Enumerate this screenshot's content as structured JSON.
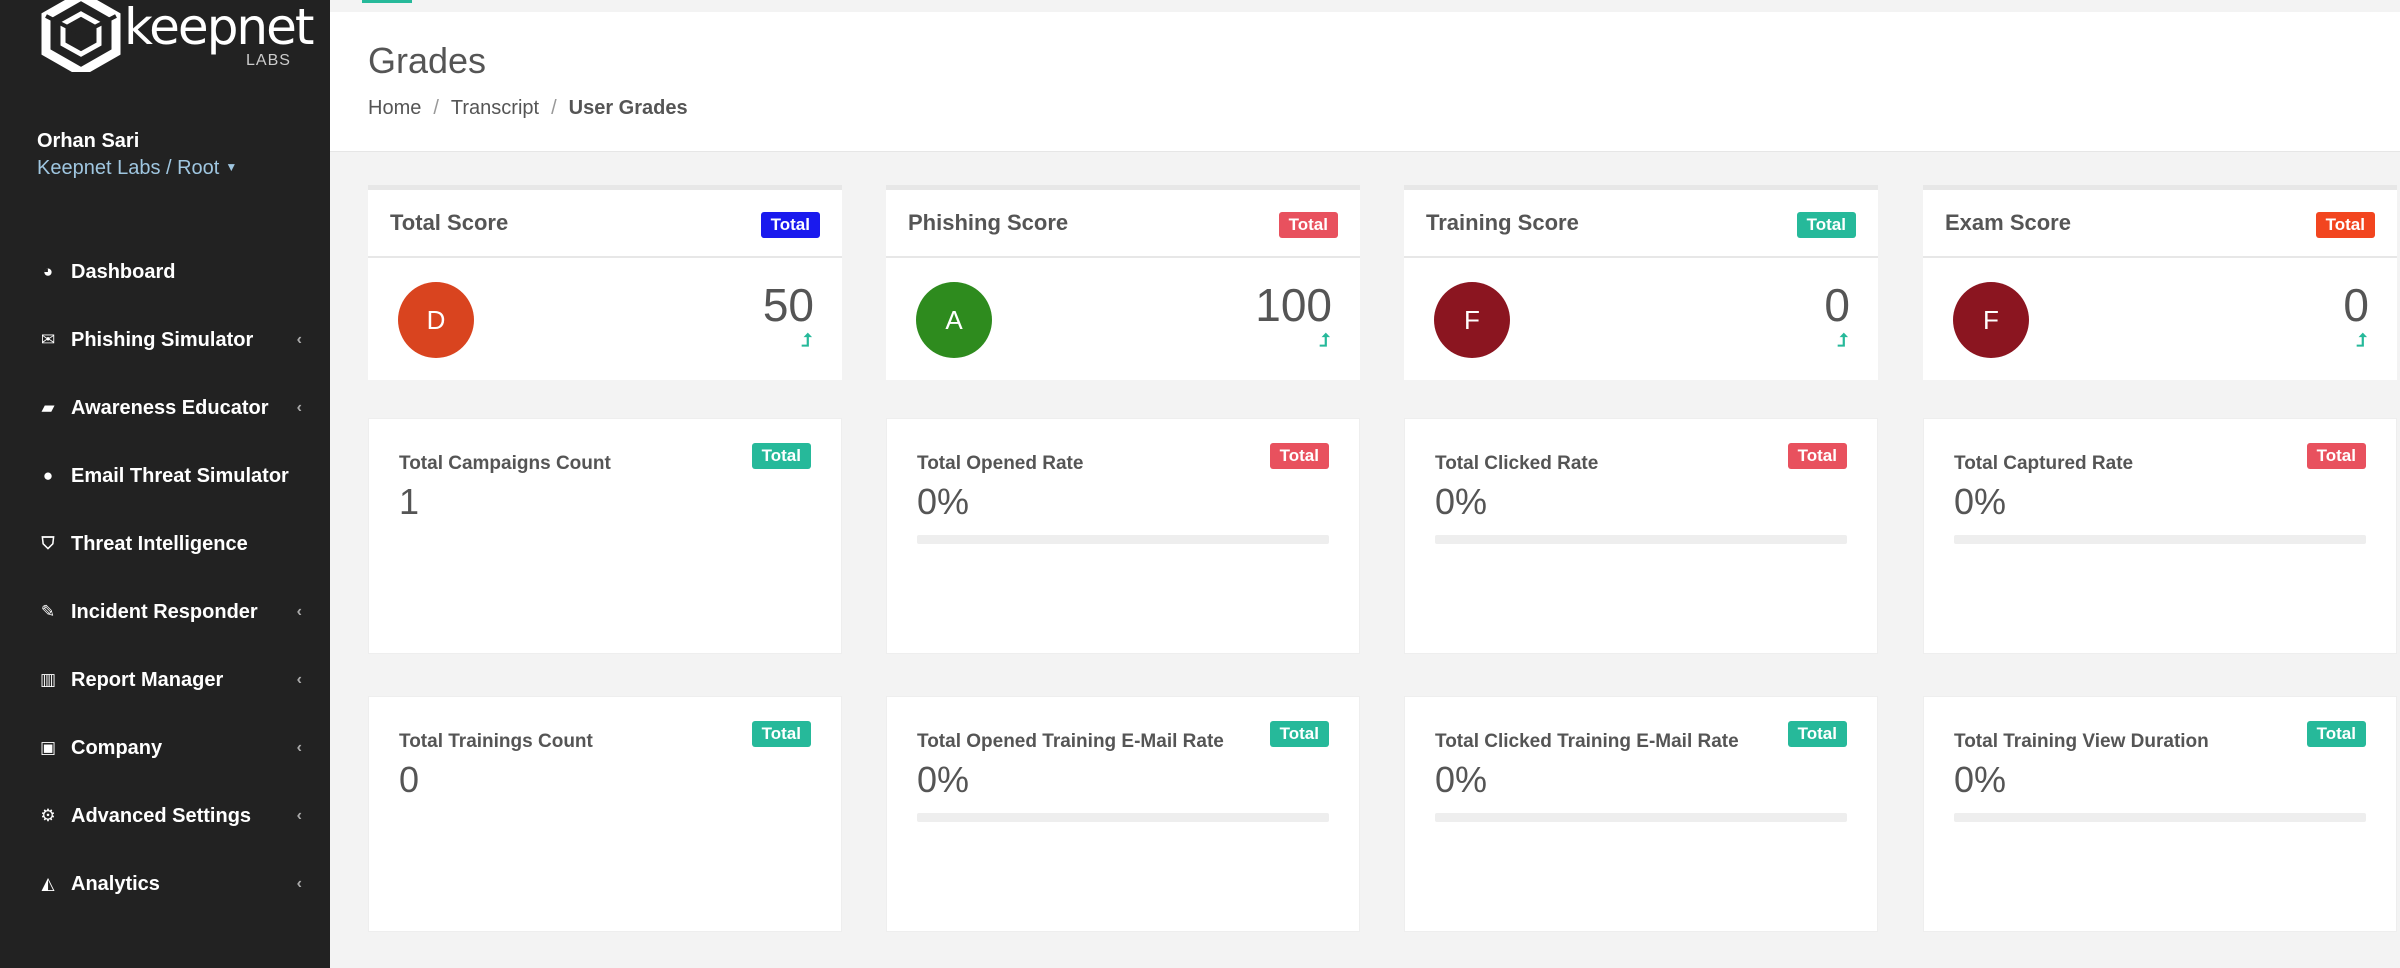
{
  "sidebar": {
    "logo_text": "keepnet",
    "logo_sub": "LABS",
    "user_name": "Orhan Sari",
    "user_org": "Keepnet Labs / Root",
    "items": [
      {
        "label": "Dashboard",
        "icon": "dashboard-icon",
        "has_submenu": false
      },
      {
        "label": "Phishing Simulator",
        "icon": "envelope-icon",
        "has_submenu": true
      },
      {
        "label": "Awareness Educator",
        "icon": "book-icon",
        "has_submenu": true
      },
      {
        "label": "Email Threat Simulator",
        "icon": "globe-icon",
        "has_submenu": false
      },
      {
        "label": "Threat Intelligence",
        "icon": "shield-icon",
        "has_submenu": false
      },
      {
        "label": "Incident Responder",
        "icon": "flame-icon",
        "has_submenu": true
      },
      {
        "label": "Report Manager",
        "icon": "bar-chart-icon",
        "has_submenu": true
      },
      {
        "label": "Company",
        "icon": "briefcase-icon",
        "has_submenu": true
      },
      {
        "label": "Advanced Settings",
        "icon": "cogs-icon",
        "has_submenu": true
      },
      {
        "label": "Analytics",
        "icon": "area-chart-icon",
        "has_submenu": true
      }
    ]
  },
  "header": {
    "title": "Grades",
    "breadcrumb": [
      "Home",
      "Transcript",
      "User Grades"
    ]
  },
  "score_cards": [
    {
      "title": "Total Score",
      "badge": "Total",
      "badge_color": "#1a1aee",
      "grade": "D",
      "grade_color": "#d9441f",
      "value": "50",
      "arrow": "⮥"
    },
    {
      "title": "Phishing Score",
      "badge": "Total",
      "badge_color": "#e8515e",
      "grade": "A",
      "grade_color": "#2e8b1e",
      "value": "100",
      "arrow": "⮥"
    },
    {
      "title": "Training Score",
      "badge": "Total",
      "badge_color": "#26b99a",
      "grade": "F",
      "grade_color": "#8b1520",
      "value": "0",
      "arrow": "⮥"
    },
    {
      "title": "Exam Score",
      "badge": "Total",
      "badge_color": "#f2451f",
      "grade": "F",
      "grade_color": "#8b1520",
      "value": "0",
      "arrow": "⮥"
    }
  ],
  "stat_rows": [
    [
      {
        "title": "Total Campaigns Count",
        "badge": "Total",
        "badge_color": "#26b99a",
        "value": "1",
        "progress": null
      },
      {
        "title": "Total Opened Rate",
        "badge": "Total",
        "badge_color": "#e8515e",
        "value": "0%",
        "progress": 0
      },
      {
        "title": "Total Clicked Rate",
        "badge": "Total",
        "badge_color": "#e8515e",
        "value": "0%",
        "progress": 0
      },
      {
        "title": "Total Captured Rate",
        "badge": "Total",
        "badge_color": "#e8515e",
        "value": "0%",
        "progress": 0
      }
    ],
    [
      {
        "title": "Total Trainings Count",
        "badge": "Total",
        "badge_color": "#26b99a",
        "value": "0",
        "progress": null
      },
      {
        "title": "Total Opened Training E-Mail Rate",
        "badge": "Total",
        "badge_color": "#26b99a",
        "value": "0%",
        "progress": 0
      },
      {
        "title": "Total Clicked Training E-Mail Rate",
        "badge": "Total",
        "badge_color": "#26b99a",
        "value": "0%",
        "progress": 0
      },
      {
        "title": "Total Training View Duration",
        "badge": "Total",
        "badge_color": "#26b99a",
        "value": "0%",
        "progress": 0
      }
    ]
  ]
}
